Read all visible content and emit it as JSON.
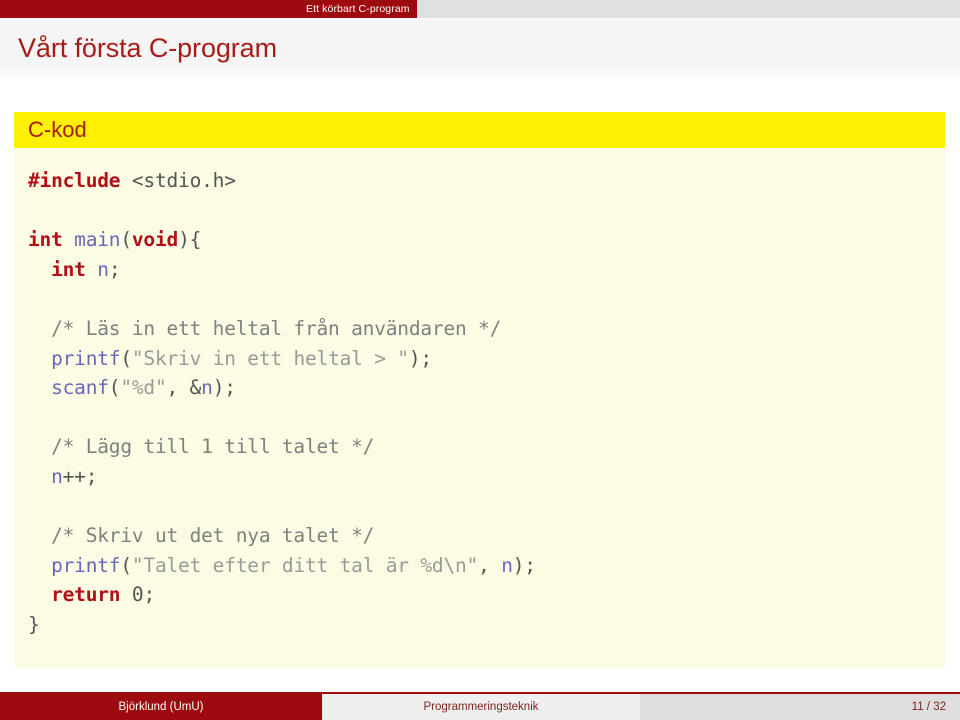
{
  "navbar": {
    "current_section": "Ett körbart C-program"
  },
  "frame": {
    "title": "Vårt första C-program"
  },
  "block": {
    "heading": "C-kod",
    "code_lines": [
      [
        {
          "t": "#include",
          "c": "kw"
        },
        {
          "t": " ",
          "c": "pun"
        },
        {
          "t": "<stdio.h>",
          "c": "pun"
        }
      ],
      [],
      [
        {
          "t": "int",
          "c": "kw"
        },
        {
          "t": " ",
          "c": "pun"
        },
        {
          "t": "main",
          "c": "fn"
        },
        {
          "t": "(",
          "c": "pun"
        },
        {
          "t": "void",
          "c": "kw"
        },
        {
          "t": "){",
          "c": "pun"
        }
      ],
      [
        {
          "t": "  ",
          "c": "pun"
        },
        {
          "t": "int",
          "c": "kw"
        },
        {
          "t": " ",
          "c": "pun"
        },
        {
          "t": "n",
          "c": "var"
        },
        {
          "t": ";",
          "c": "pun"
        }
      ],
      [],
      [
        {
          "t": "  ",
          "c": "pun"
        },
        {
          "t": "/* Läs in ett heltal från användaren */",
          "c": "cmt"
        }
      ],
      [
        {
          "t": "  ",
          "c": "pun"
        },
        {
          "t": "printf",
          "c": "fn"
        },
        {
          "t": "(",
          "c": "pun"
        },
        {
          "t": "\"Skriv in ett heltal > \"",
          "c": "str"
        },
        {
          "t": ");",
          "c": "pun"
        }
      ],
      [
        {
          "t": "  ",
          "c": "pun"
        },
        {
          "t": "scanf",
          "c": "fn"
        },
        {
          "t": "(",
          "c": "pun"
        },
        {
          "t": "\"%d\"",
          "c": "str"
        },
        {
          "t": ", &",
          "c": "pun"
        },
        {
          "t": "n",
          "c": "var"
        },
        {
          "t": ");",
          "c": "pun"
        }
      ],
      [],
      [
        {
          "t": "  ",
          "c": "pun"
        },
        {
          "t": "/* Lägg till 1 till talet */",
          "c": "cmt"
        }
      ],
      [
        {
          "t": "  ",
          "c": "pun"
        },
        {
          "t": "n",
          "c": "var"
        },
        {
          "t": "++;",
          "c": "pun"
        }
      ],
      [],
      [
        {
          "t": "  ",
          "c": "pun"
        },
        {
          "t": "/* Skriv ut det nya talet */",
          "c": "cmt"
        }
      ],
      [
        {
          "t": "  ",
          "c": "pun"
        },
        {
          "t": "printf",
          "c": "fn"
        },
        {
          "t": "(",
          "c": "pun"
        },
        {
          "t": "\"Talet efter ditt tal är %d\\n\"",
          "c": "str"
        },
        {
          "t": ", ",
          "c": "pun"
        },
        {
          "t": "n",
          "c": "var"
        },
        {
          "t": ");",
          "c": "pun"
        }
      ],
      [
        {
          "t": "  ",
          "c": "pun"
        },
        {
          "t": "return",
          "c": "kw"
        },
        {
          "t": " ",
          "c": "pun"
        },
        {
          "t": "0",
          "c": "num"
        },
        {
          "t": ";",
          "c": "pun"
        }
      ],
      [
        {
          "t": "}",
          "c": "pun"
        }
      ]
    ]
  },
  "footer": {
    "author": "Björklund (UmU)",
    "course": "Programmeringsteknik",
    "page": "11 / 32"
  },
  "colors": {
    "brand_red": "#9e0b0f",
    "title_red": "#a51c18",
    "highlight_yellow": "#ffef00",
    "code_bg": "#fcfbe3",
    "keyword_red": "#b01017",
    "identifier_blue": "#6a68b8"
  }
}
